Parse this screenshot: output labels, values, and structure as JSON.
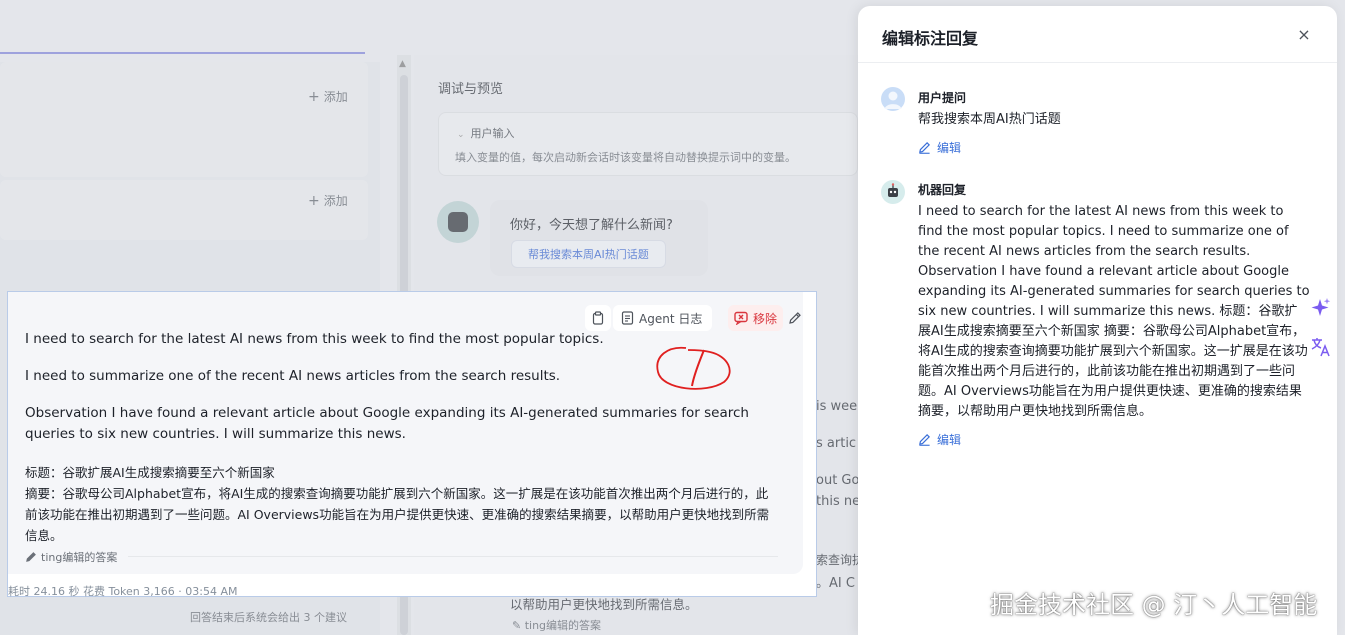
{
  "background": {
    "add_label_1": "添加",
    "add_label_2": "添加",
    "preview_title": "调试与预览",
    "user_input_title": "用户输入",
    "user_input_desc": "填入变量的值，每次启动新会话时该变量将自动替换提示词中的变量。",
    "greeting": "你好，今天想了解什么新闻?",
    "suggestion_chip": "帮我搜索本周AI热门话题",
    "frag_1": "is wee",
    "frag_2": "s artic",
    "frag_3": "out Go",
    "frag_4": "this ne",
    "frag_5": "索查询抗",
    "frag_6": "。AI C",
    "frag_7": "以帮助用户更快地找到所需信息。",
    "bottom_note": "回答结束后系统会给出 3 个建议",
    "edited_note": "ting编辑的答案"
  },
  "answer_card": {
    "toolbar": {
      "agent_log_label": "Agent 日志",
      "remove_label": "移除"
    },
    "paragraphs": [
      "I need to search for the latest AI news from this week to find the most popular topics.",
      "I need to summarize one of the recent AI news articles from the search results.",
      "Observation I have found a relevant article about Google expanding its AI-generated summaries for search queries to six new countries. I will summarize this news."
    ],
    "summary_zh": "标题：谷歌扩展AI生成搜索摘要至六个新国家\n摘要：谷歌母公司Alphabet宣布，将AI生成的搜索查询摘要功能扩展到六个新国家。这一扩展是在该功能首次推出两个月后进行的，此前该功能在推出初期遇到了一些问题。AI Overviews功能旨在为用户提供更快速、更准确的搜索结果摘要，以帮助用户更快地找到所需信息。",
    "edited_by": "ting编辑的答案",
    "meta": "耗时 24.16 秒  花费 Token 3,166  ·  03:54 AM"
  },
  "drawer": {
    "title": "编辑标注回复",
    "user_section": {
      "label": "用户提问",
      "text": "帮我搜索本周AI热门话题",
      "edit_label": "编辑"
    },
    "bot_section": {
      "label": "机器回复",
      "text": "I need to search for the latest AI news from this week to find the most popular topics. I need to summarize one of the recent AI news articles from the search results. Observation I have found a relevant article about Google expanding its AI-generated summaries for search queries to six new countries. I will summarize this news. 标题：谷歌扩展AI生成搜索摘要至六个新国家 摘要：谷歌母公司Alphabet宣布，将AI生成的搜索查询摘要功能扩展到六个新国家。这一扩展是在该功能首次推出两个月后进行的，此前该功能在推出初期遇到了一些问题。AI Overviews功能旨在为用户提供更快速、更准确的搜索结果摘要，以帮助用户更快地找到所需信息。",
      "edit_label": "编辑"
    }
  },
  "watermark": "掘金技术社区 @ 汀丶人工智能",
  "colors": {
    "accent_blue": "#3a6fd8",
    "remove_red": "#d9363e",
    "annotation_red": "#e02020"
  }
}
